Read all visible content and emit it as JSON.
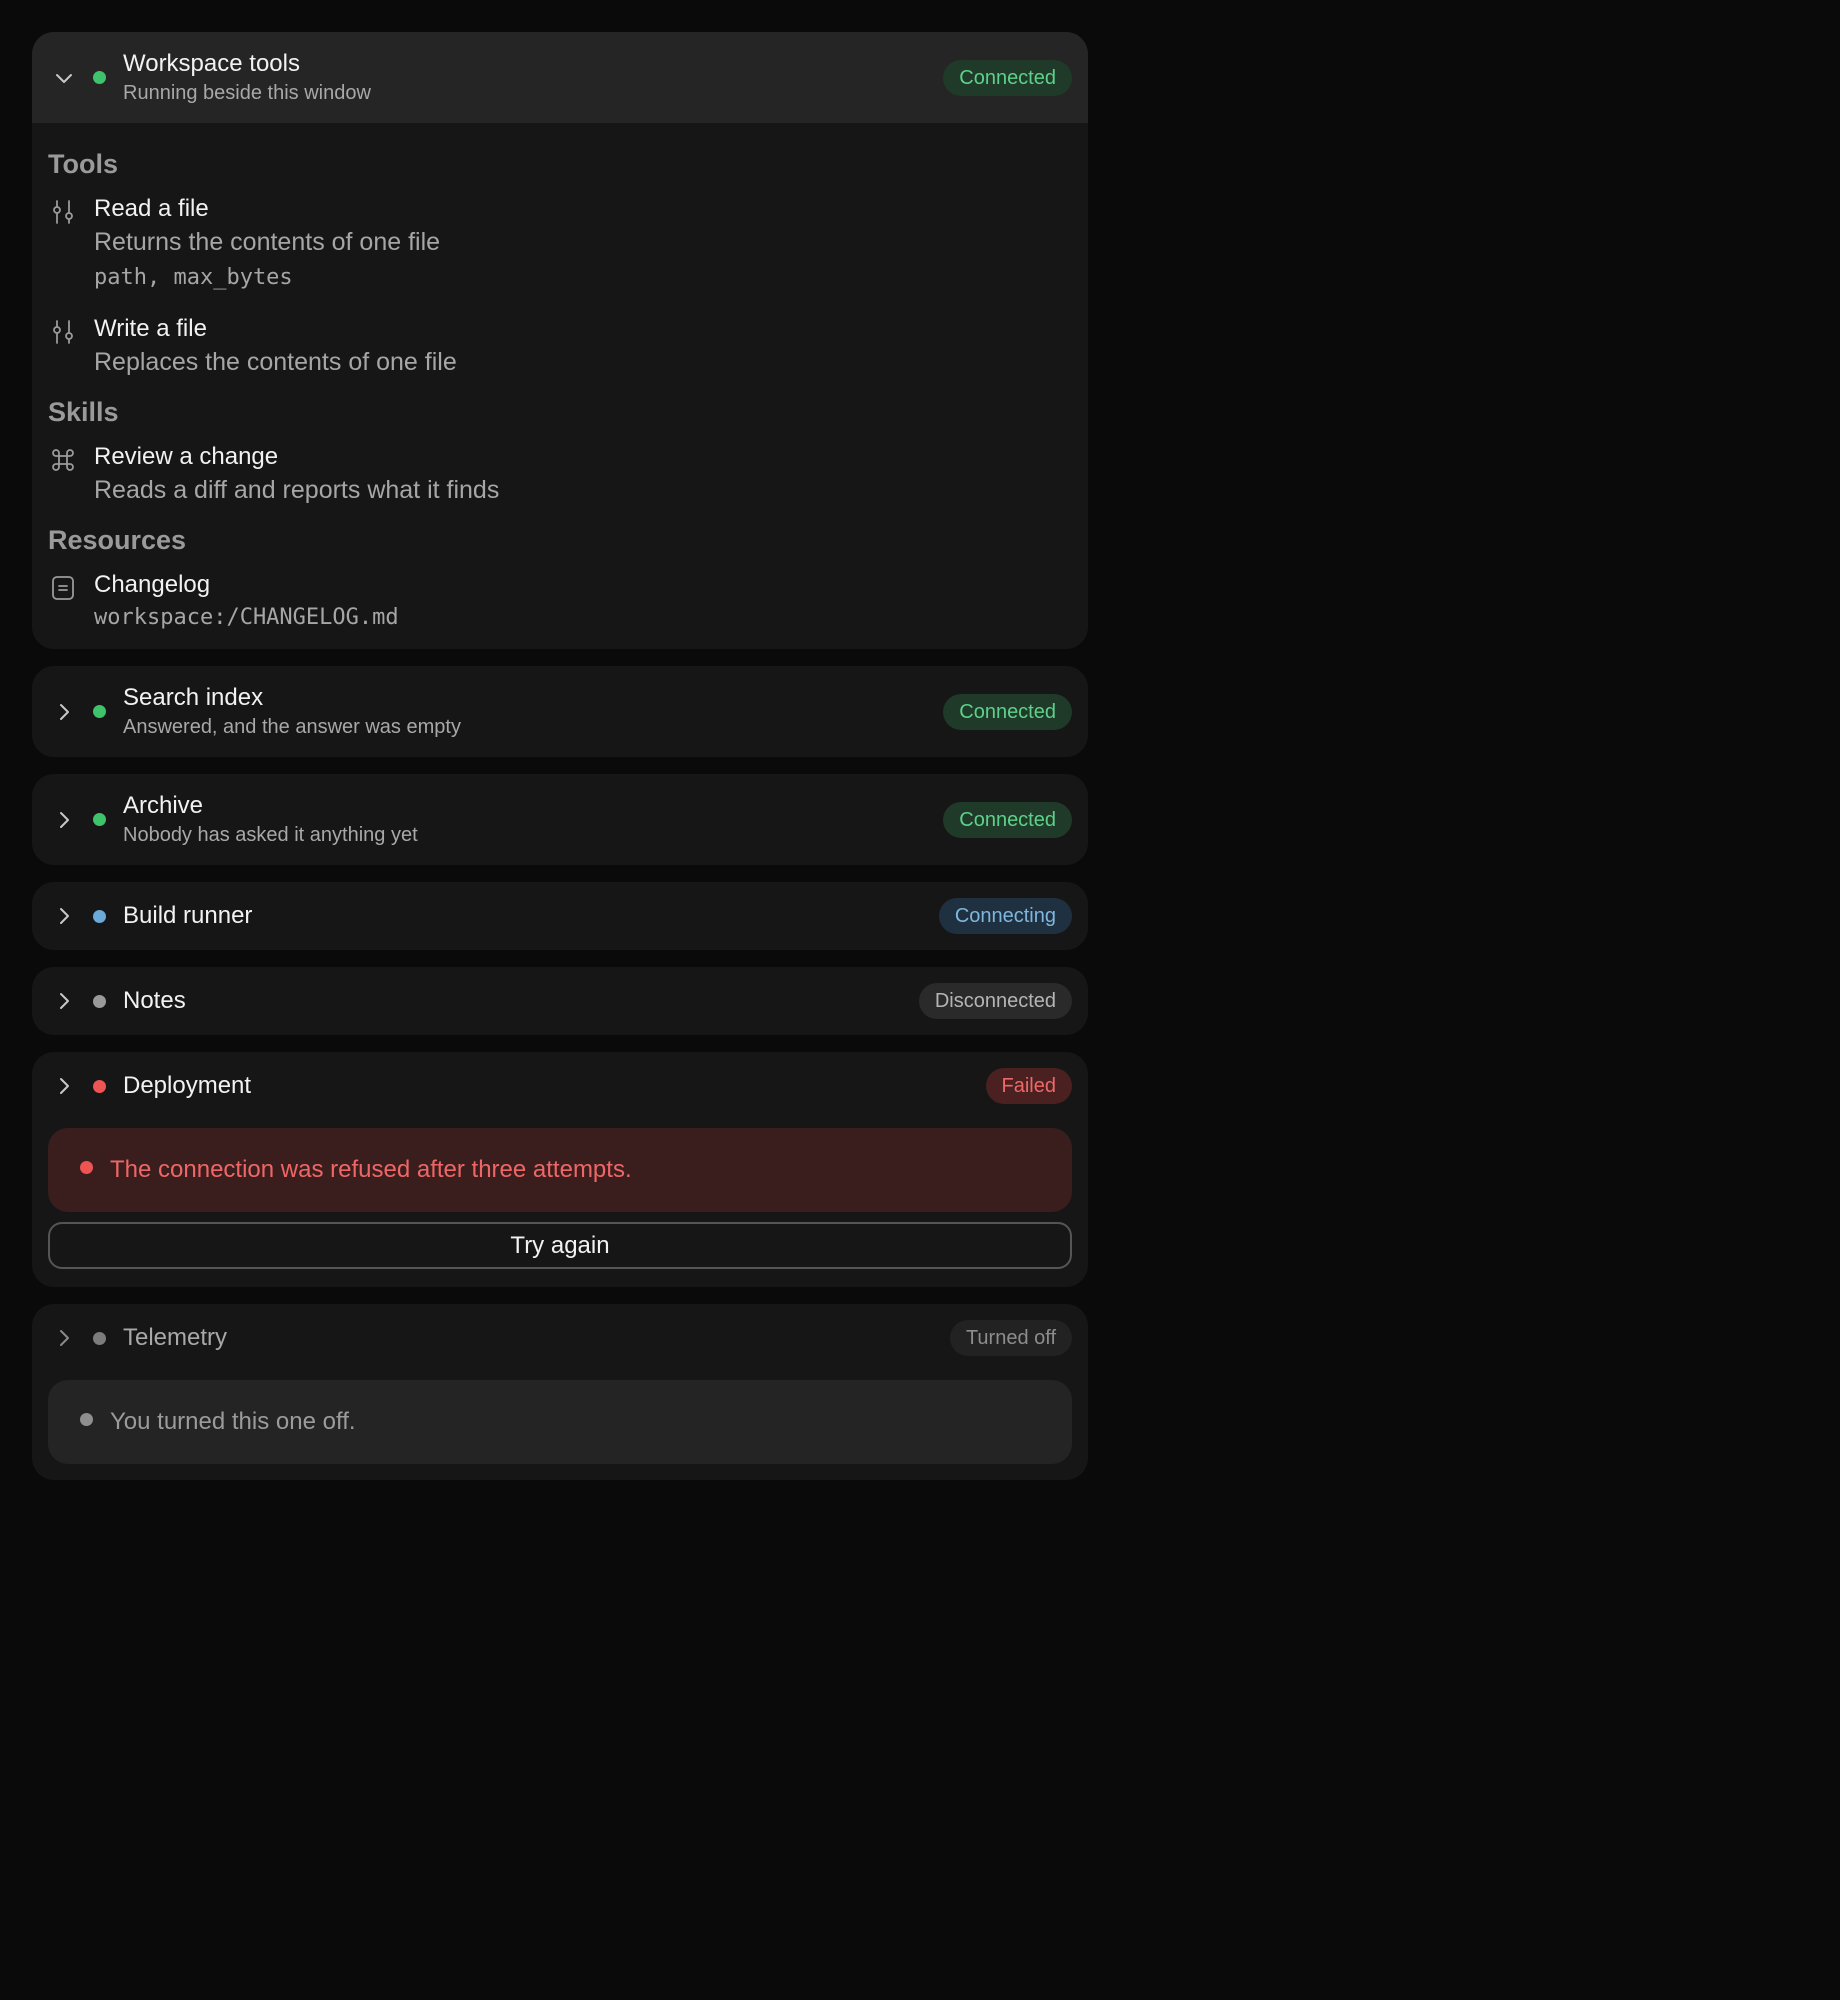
{
  "colors": {
    "connected_dot": "#3ec26b",
    "connected_badge_bg": "#1f3a29",
    "connected_badge_text": "#5ed08a",
    "connecting_dot": "#6aa9d8",
    "connecting_badge_bg": "#1f3140",
    "connecting_badge_text": "#7fb6de",
    "disconnected_dot": "#9a9a9a",
    "disconnected_badge_bg": "#2a2a2a",
    "disconnected_badge_text": "#b5b5b5",
    "failed_dot": "#ef5454",
    "failed_badge_bg": "#4a2020",
    "failed_badge_text": "#ef6868",
    "off_dot": "#7c7c7c",
    "off_badge_bg": "#222222",
    "off_badge_text": "#8d8d8d"
  },
  "servers": [
    {
      "title": "Workspace tools",
      "subtitle": "Running beside this window",
      "status": "Connected",
      "expanded": true,
      "sections": [
        {
          "title": "Tools",
          "items": [
            {
              "icon": "sliders-icon",
              "name": "Read a file",
              "desc": "Returns the contents of one file",
              "args": "path, max_bytes"
            },
            {
              "icon": "sliders-icon",
              "name": "Write a file",
              "desc": "Replaces the contents of one file"
            }
          ]
        },
        {
          "title": "Skills",
          "items": [
            {
              "icon": "command-icon",
              "name": "Review a change",
              "desc": "Reads a diff and reports what it finds"
            }
          ]
        },
        {
          "title": "Resources",
          "items": [
            {
              "icon": "document-icon",
              "name": "Changelog",
              "args": "workspace:/CHANGELOG.md"
            }
          ]
        }
      ]
    },
    {
      "title": "Search index",
      "subtitle": "Answered, and the answer was empty",
      "status": "Connected"
    },
    {
      "title": "Archive",
      "subtitle": "Nobody has asked it anything yet",
      "status": "Connected"
    },
    {
      "title": "Build runner",
      "status": "Connecting"
    },
    {
      "title": "Notes",
      "status": "Disconnected"
    },
    {
      "title": "Deployment",
      "status": "Failed",
      "error": "The connection was refused after three attempts.",
      "retry_label": "Try again"
    },
    {
      "title": "Telemetry",
      "status": "Turned off",
      "off_message": "You turned this one off."
    }
  ]
}
